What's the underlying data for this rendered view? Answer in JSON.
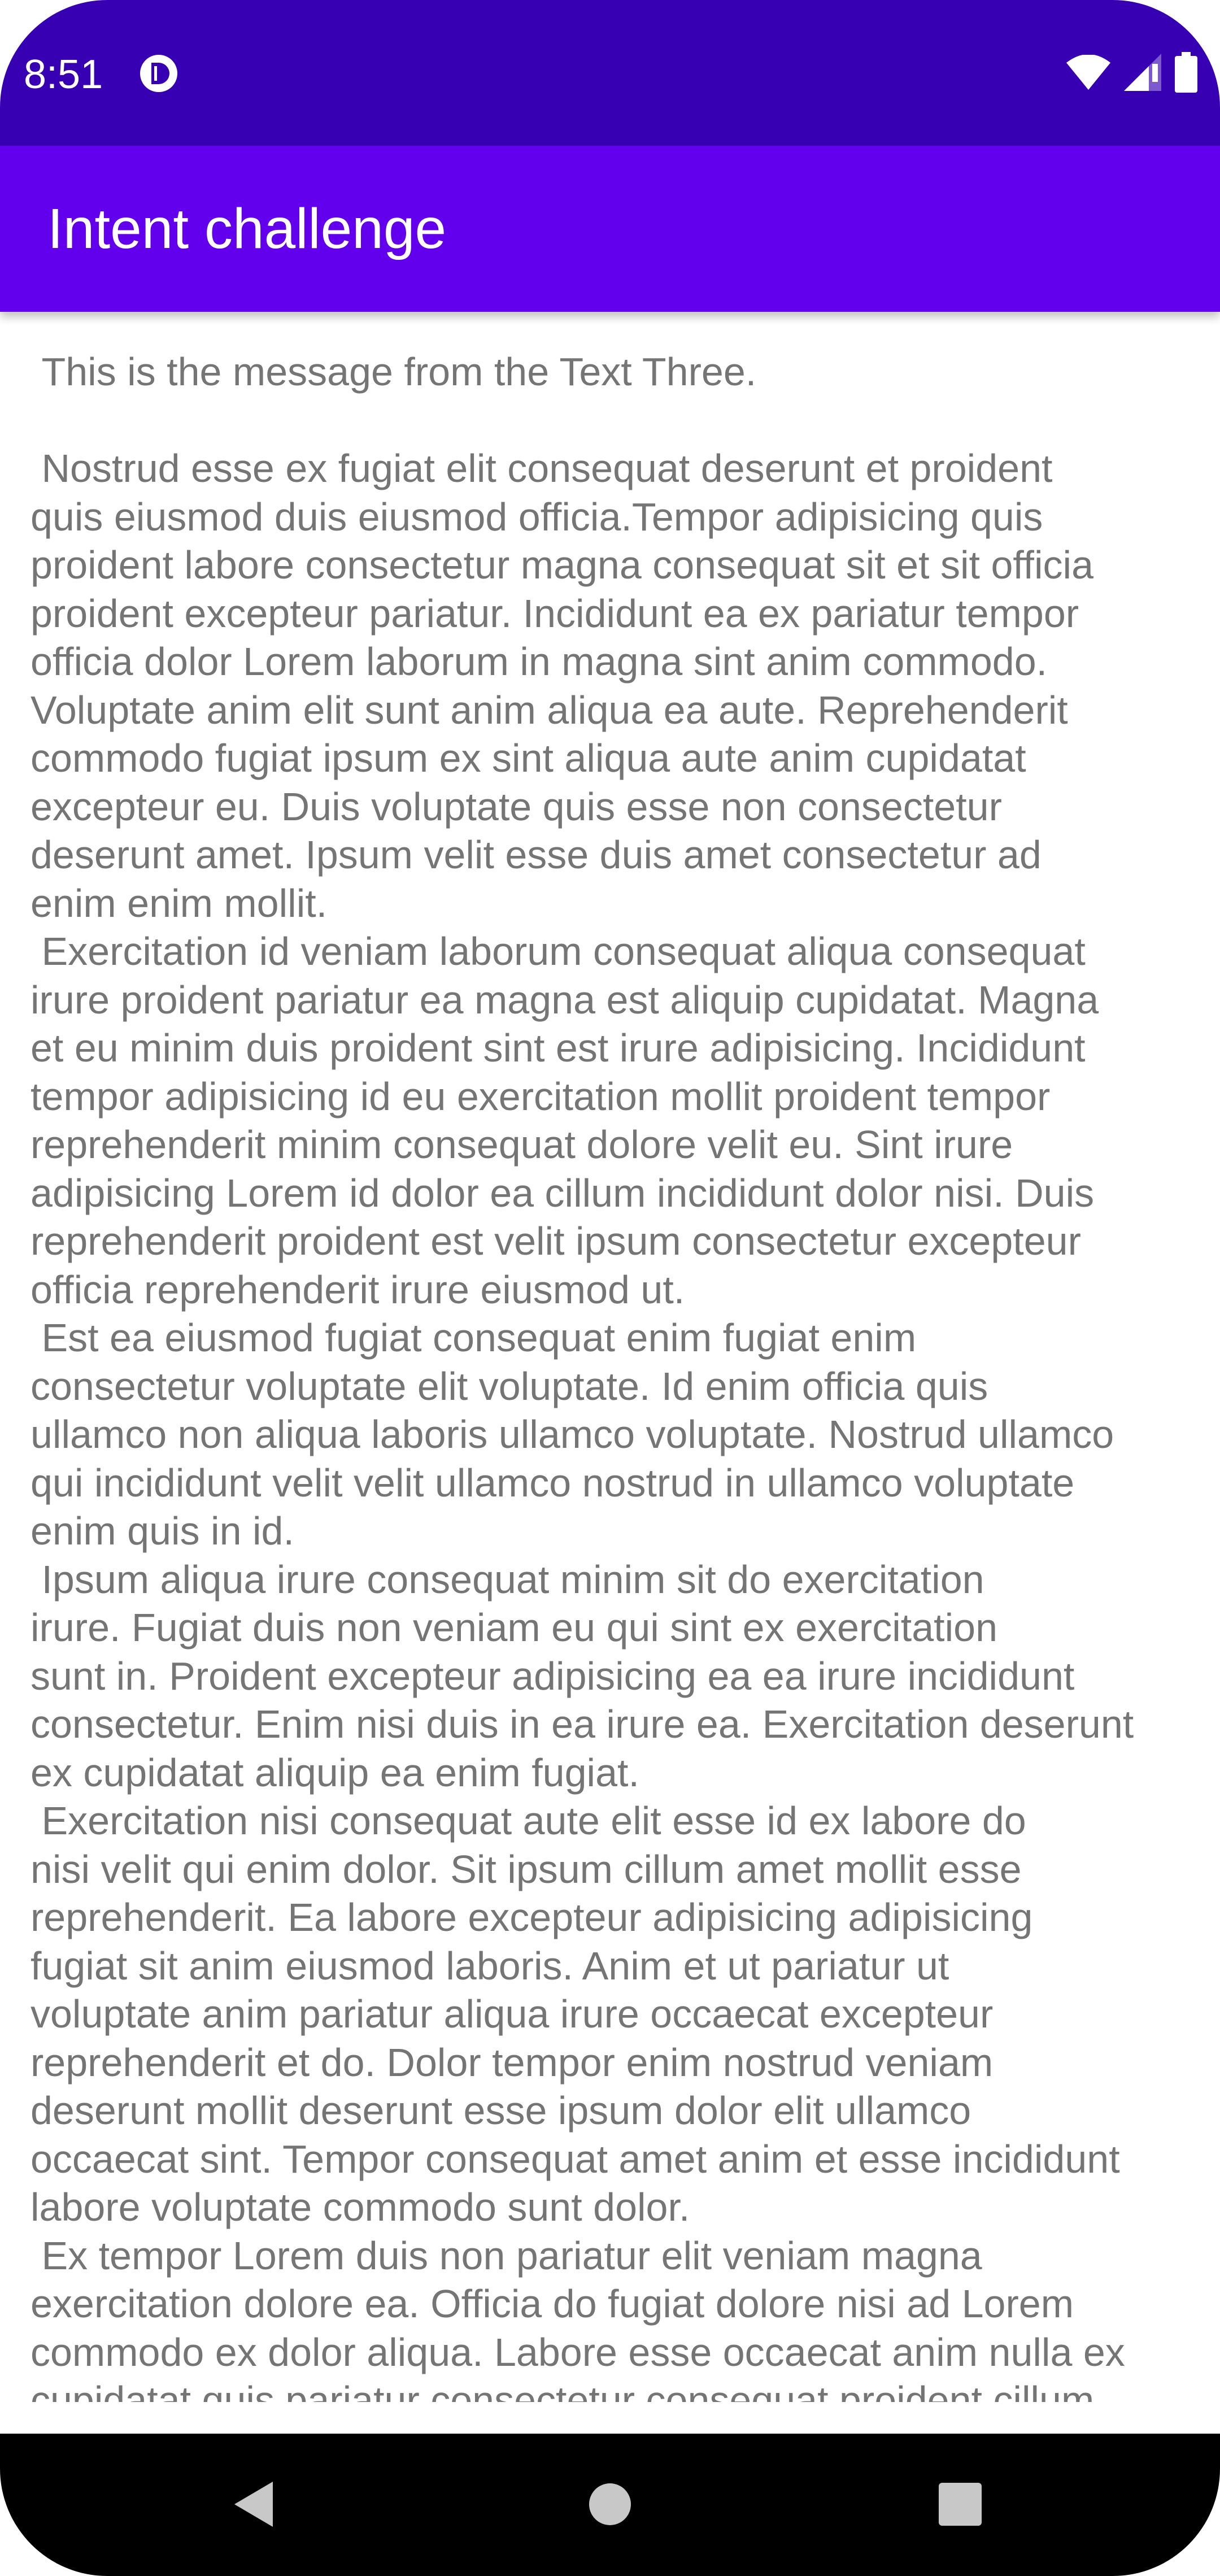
{
  "status_bar": {
    "time": "8:51",
    "app_icon": "notification-app-icon",
    "icons": [
      "wifi-icon",
      "cell-signal-icon",
      "battery-icon"
    ]
  },
  "app_bar": {
    "title": "Intent challenge"
  },
  "content": {
    "message": " This is the message from the Text Three.\n\n Nostrud esse ex fugiat elit consequat deserunt et proident\nquis eiusmod duis eiusmod officia.Tempor adipisicing quis\nproident labore consectetur magna consequat sit et sit officia\nproident excepteur pariatur. Incididunt ea ex pariatur tempor\nofficia dolor Lorem laborum in magna sint anim commodo.\nVoluptate anim elit sunt anim aliqua ea aute. Reprehenderit\ncommodo fugiat ipsum ex sint aliqua aute anim cupidatat\nexcepteur eu. Duis voluptate quis esse non consectetur\ndeserunt amet. Ipsum velit esse duis amet consectetur ad\nenim enim mollit.\n Exercitation id veniam laborum consequat aliqua consequat\nirure proident pariatur ea magna est aliquip cupidatat. Magna\net eu minim duis proident sint est irure adipisicing. Incididunt\ntempor adipisicing id eu exercitation mollit proident tempor\nreprehenderit minim consequat dolore velit eu. Sint irure\nadipisicing Lorem id dolor ea cillum incididunt dolor nisi. Duis\nreprehenderit proident est velit ipsum consectetur excepteur\nofficia reprehenderit irure eiusmod ut.\n Est ea eiusmod fugiat consequat enim fugiat enim\nconsectetur voluptate elit voluptate. Id enim officia quis\nullamco non aliqua laboris ullamco voluptate. Nostrud ullamco\nqui incididunt velit velit ullamco nostrud in ullamco voluptate\nenim quis in id.\n Ipsum aliqua irure consequat minim sit do exercitation\nirure. Fugiat duis non veniam eu qui sint ex exercitation\nsunt in. Proident excepteur adipisicing ea ea irure incididunt\nconsectetur. Enim nisi duis in ea irure ea. Exercitation deserunt\nex cupidatat aliquip ea enim fugiat.\n Exercitation nisi consequat aute elit esse id ex labore do\nnisi velit qui enim dolor. Sit ipsum cillum amet mollit esse\nreprehenderit. Ea labore excepteur adipisicing adipisicing\nfugiat sit anim eiusmod laboris. Anim et ut pariatur ut\nvoluptate anim pariatur aliqua irure occaecat excepteur\nreprehenderit et do. Dolor tempor enim nostrud veniam\ndeserunt mollit deserunt esse ipsum dolor elit ullamco\noccaecat sint. Tempor consequat amet anim et esse incididunt\nlabore voluptate commodo sunt dolor.\n Ex tempor Lorem duis non pariatur elit veniam magna\nexercitation dolore ea. Officia do fugiat dolore nisi ad Lorem\ncommodo ex dolor aliqua. Labore esse occaecat anim nulla ex\ncupidatat quis pariatur consectetur consequat proident cillum"
  },
  "nav_bar": {
    "buttons": [
      "back-icon",
      "home-icon",
      "recents-icon"
    ]
  },
  "colors": {
    "status_bar": "#3700b3",
    "app_bar": "#6200ee",
    "body_text": "#757575",
    "nav_bar": "#000000"
  }
}
